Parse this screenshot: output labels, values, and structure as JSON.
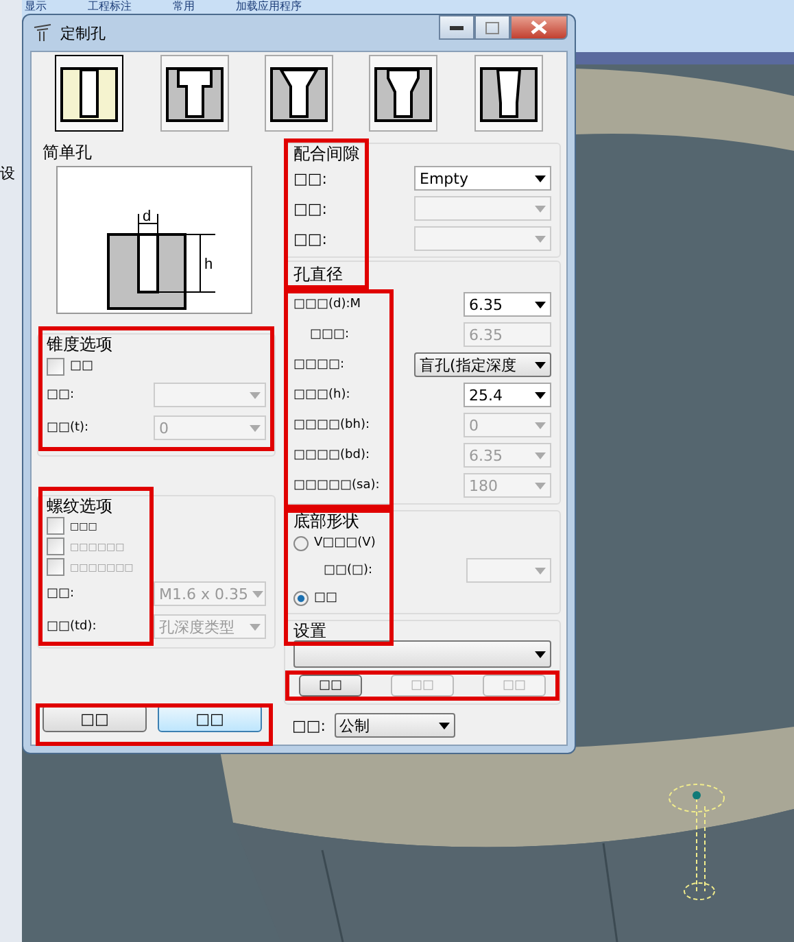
{
  "menu": [
    "显示",
    "工程标注",
    "常用",
    "加载应用程序"
  ],
  "side_text": "设",
  "dialog": {
    "title": "定制孔",
    "hole_types": [
      {
        "kind": "simple",
        "selected": true
      },
      {
        "kind": "counterbore",
        "selected": false
      },
      {
        "kind": "countersink",
        "selected": false
      },
      {
        "kind": "counterdrill",
        "selected": false
      },
      {
        "kind": "tapered",
        "selected": false
      }
    ],
    "simple_hole": {
      "title": "简单孔",
      "dim_d": "d",
      "dim_h": "h"
    },
    "taper": {
      "title": "锥度选项",
      "check": {
        "label": "□□",
        "checked": false,
        "disabled": false
      },
      "fields": [
        {
          "label": "□□:",
          "disabled": true
        },
        {
          "label": "□□(t):",
          "value": "0",
          "disabled": true
        }
      ]
    },
    "thread": {
      "title": "螺纹选项",
      "checks": [
        {
          "label": "□□□",
          "checked": false,
          "disabled": false
        },
        {
          "label": "□□□□□□",
          "checked": false,
          "disabled": true
        },
        {
          "label": "□□□□□□□",
          "checked": false,
          "disabled": true
        }
      ],
      "fields": [
        {
          "label": "□□:",
          "value": "M1.6 x 0.35",
          "disabled": true
        },
        {
          "label": "□□(td):",
          "value": "孔深度类型",
          "disabled": true
        }
      ]
    },
    "fit": {
      "title": "配合间隙",
      "rows": [
        {
          "label": "□□:",
          "value": "Empty",
          "disabled": false
        },
        {
          "label": "□□:",
          "disabled": true
        },
        {
          "label": "□□:",
          "disabled": true
        }
      ]
    },
    "diameter": {
      "title": "孔直径",
      "rows": [
        {
          "kind": "combo",
          "label": "□□□(d):M",
          "value": "6.35",
          "disabled": false
        },
        {
          "kind": "readout",
          "label": "□□□:",
          "value": "6.35",
          "disabled": true
        },
        {
          "kind": "dropdown",
          "label": "□□□□:",
          "value": "盲孔(指定深度",
          "disabled": false
        },
        {
          "kind": "combo",
          "label": "□□□(h):",
          "value": "25.4",
          "disabled": false
        },
        {
          "kind": "combo",
          "label": "□□□□(bh):",
          "value": "0",
          "disabled": true
        },
        {
          "kind": "combo",
          "label": "□□□□(bd):",
          "value": "6.35",
          "disabled": true
        },
        {
          "kind": "combo",
          "label": "□□□□□(sa):",
          "value": "180",
          "disabled": true
        }
      ]
    },
    "bottom": {
      "title": "底部形状",
      "options": [
        {
          "label": "V□□□(V)",
          "selected": false
        },
        {
          "label": "□□",
          "selected": true
        }
      ],
      "angle": {
        "label": "□□(□):",
        "disabled": true
      }
    },
    "settings": {
      "title": "设置",
      "buttons": [
        {
          "label": "□□",
          "disabled": false
        },
        {
          "label": "□□",
          "disabled": true
        },
        {
          "label": "□□",
          "disabled": true
        }
      ]
    },
    "units": {
      "label": "□□:",
      "value": "公制"
    },
    "footer_buttons": [
      {
        "label": "□□",
        "focused": false
      },
      {
        "label": "□□",
        "focused": true
      }
    ]
  }
}
